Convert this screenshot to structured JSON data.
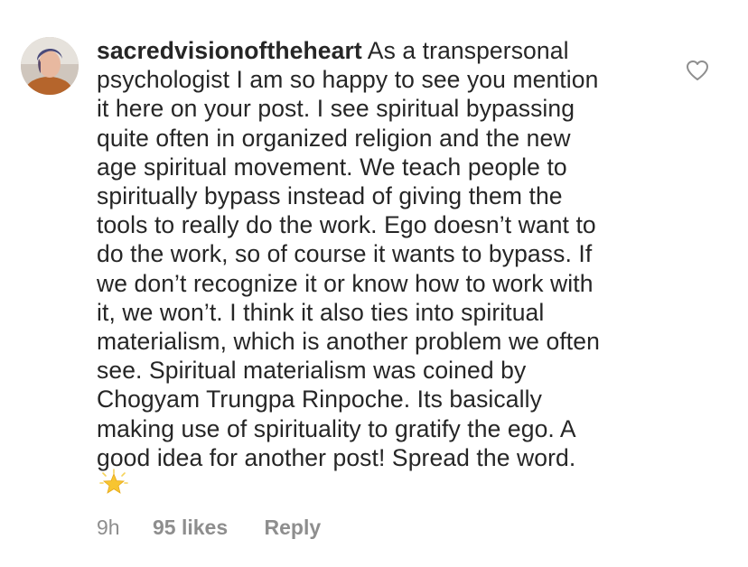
{
  "comment": {
    "username": "sacredvisionoftheheart",
    "lines": [
      " As a transpersonal",
      "psychologist I am so happy to see you mention",
      "it here on your post. I see spiritual bypassing",
      "quite often in organized religion and the new",
      "age spiritual movement. We teach people to",
      "spiritually bypass instead of giving them the",
      "tools to really do the work. Ego doesn’t want to",
      "do the work, so of course it wants to bypass. If",
      "we don’t recognize it or know how to work with",
      "it, we won’t. I think it also ties into spiritual",
      "materialism, which is another problem we often",
      "see. Spiritual materialism was coined by",
      "Chogyam Trungpa Rinpoche. Its basically",
      "making use of spirituality to gratify the ego. A",
      "good idea for another post! Spread the word."
    ],
    "emoji": "glowing-star-icon",
    "time": "9h",
    "likes": "95 likes",
    "reply_label": "Reply"
  },
  "colors": {
    "text": "#262626",
    "meta": "#8e8e8e",
    "heart_stroke": "#8e8e8e",
    "star": "#f7c531"
  }
}
